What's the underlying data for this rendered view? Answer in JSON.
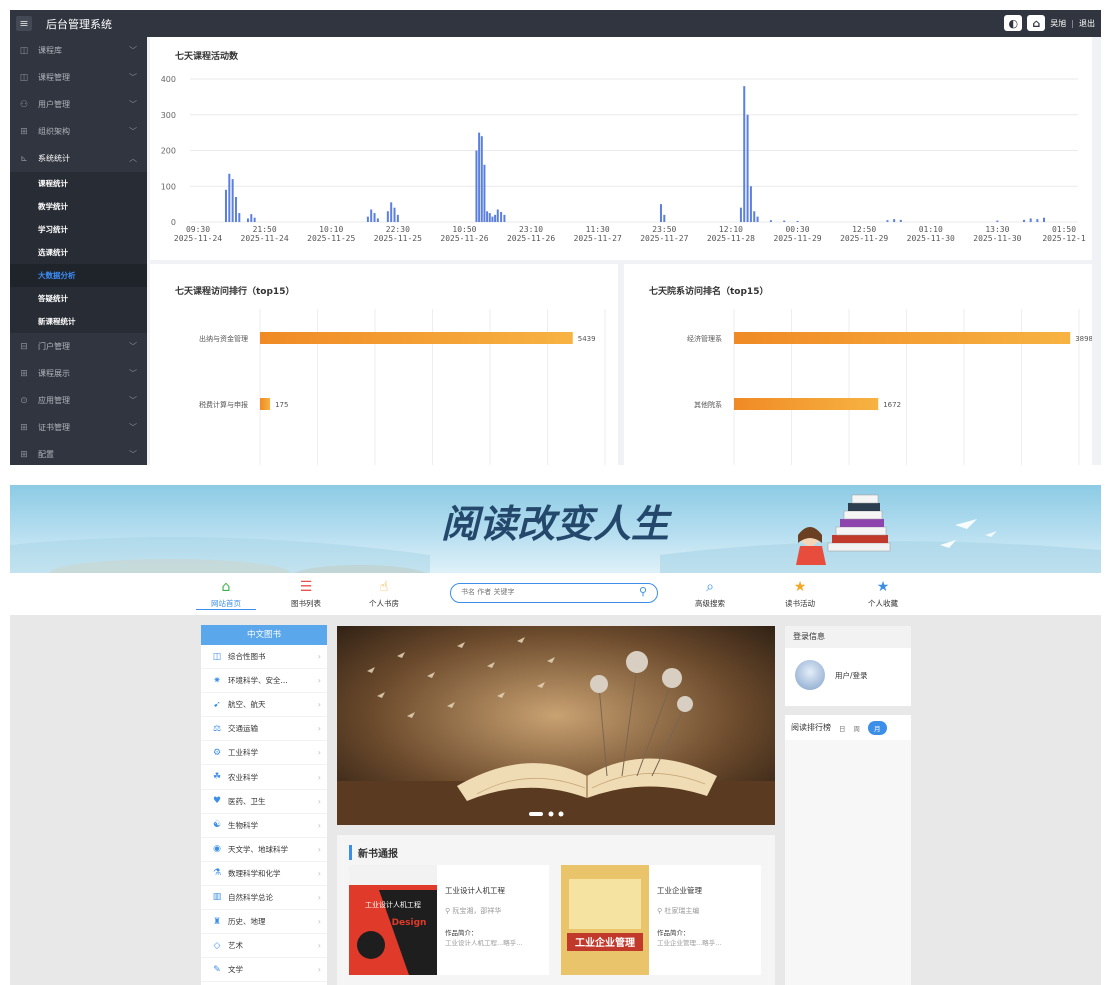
{
  "admin": {
    "app_title": "后台管理系统",
    "user_name": "吴旭",
    "logout": "退出",
    "sidebar": {
      "items_before": [
        {
          "label": "课程库",
          "icon": "book-icon"
        },
        {
          "label": "课程管理",
          "icon": "book-icon"
        },
        {
          "label": "用户管理",
          "icon": "user-icon"
        },
        {
          "label": "组织架构",
          "icon": "grid-icon"
        },
        {
          "label": "系统统计",
          "icon": "chart-icon"
        }
      ],
      "subs": [
        {
          "label": "课程统计"
        },
        {
          "label": "教学统计"
        },
        {
          "label": "学习统计"
        },
        {
          "label": "选课统计"
        },
        {
          "label": "大数据分析"
        },
        {
          "label": "答疑统计"
        },
        {
          "label": "新课程统计"
        }
      ],
      "items_after": [
        {
          "label": "门户管理",
          "icon": "portal-icon"
        },
        {
          "label": "课程展示",
          "icon": "grid-icon"
        },
        {
          "label": "应用管理",
          "icon": "app-icon"
        },
        {
          "label": "证书管理",
          "icon": "grid-icon"
        },
        {
          "label": "配置",
          "icon": "grid-icon"
        }
      ]
    },
    "activity_card": {
      "title": "七天课程活动数"
    },
    "course_card": {
      "title": "七天课程访问排行（top15）"
    },
    "dept_card": {
      "title": "七天院系访问排名（top15）"
    }
  },
  "chart_data": [
    {
      "type": "bar",
      "title": "七天课程活动数",
      "ylim": [
        0,
        400
      ],
      "yticks": [
        0,
        100,
        200,
        300,
        400
      ],
      "xticks": [
        {
          "time": "09:30",
          "date": "2025-11-24"
        },
        {
          "time": "21:50",
          "date": "2025-11-24"
        },
        {
          "time": "10:10",
          "date": "2025-11-25"
        },
        {
          "time": "22:30",
          "date": "2025-11-25"
        },
        {
          "time": "10:50",
          "date": "2025-11-26"
        },
        {
          "time": "23:10",
          "date": "2025-11-26"
        },
        {
          "time": "11:30",
          "date": "2025-11-27"
        },
        {
          "time": "23:50",
          "date": "2025-11-27"
        },
        {
          "time": "12:10",
          "date": "2025-11-28"
        },
        {
          "time": "00:30",
          "date": "2025-11-29"
        },
        {
          "time": "12:50",
          "date": "2025-11-29"
        },
        {
          "time": "01:10",
          "date": "2025-11-30"
        },
        {
          "time": "13:30",
          "date": "2025-11-30"
        },
        {
          "time": "01:50",
          "date": "2025-12-1"
        }
      ],
      "points": [
        {
          "x": 0.42,
          "y": 90
        },
        {
          "x": 0.47,
          "y": 135
        },
        {
          "x": 0.52,
          "y": 120
        },
        {
          "x": 0.57,
          "y": 70
        },
        {
          "x": 0.62,
          "y": 25
        },
        {
          "x": 0.75,
          "y": 10
        },
        {
          "x": 0.8,
          "y": 22
        },
        {
          "x": 0.85,
          "y": 12
        },
        {
          "x": 2.55,
          "y": 15
        },
        {
          "x": 2.6,
          "y": 35
        },
        {
          "x": 2.65,
          "y": 25
        },
        {
          "x": 2.7,
          "y": 10
        },
        {
          "x": 2.85,
          "y": 30
        },
        {
          "x": 2.9,
          "y": 55
        },
        {
          "x": 2.95,
          "y": 40
        },
        {
          "x": 3.0,
          "y": 20
        },
        {
          "x": 4.18,
          "y": 200
        },
        {
          "x": 4.22,
          "y": 250
        },
        {
          "x": 4.26,
          "y": 240
        },
        {
          "x": 4.3,
          "y": 160
        },
        {
          "x": 4.34,
          "y": 30
        },
        {
          "x": 4.38,
          "y": 25
        },
        {
          "x": 4.42,
          "y": 15
        },
        {
          "x": 4.46,
          "y": 20
        },
        {
          "x": 4.5,
          "y": 35
        },
        {
          "x": 4.55,
          "y": 28
        },
        {
          "x": 4.6,
          "y": 20
        },
        {
          "x": 6.95,
          "y": 50
        },
        {
          "x": 7.0,
          "y": 20
        },
        {
          "x": 8.15,
          "y": 40
        },
        {
          "x": 8.2,
          "y": 380
        },
        {
          "x": 8.25,
          "y": 300
        },
        {
          "x": 8.3,
          "y": 100
        },
        {
          "x": 8.35,
          "y": 30
        },
        {
          "x": 8.4,
          "y": 15
        },
        {
          "x": 8.6,
          "y": 5
        },
        {
          "x": 8.8,
          "y": 4
        },
        {
          "x": 9.0,
          "y": 3
        },
        {
          "x": 10.35,
          "y": 5
        },
        {
          "x": 10.45,
          "y": 8
        },
        {
          "x": 10.55,
          "y": 6
        },
        {
          "x": 12.0,
          "y": 4
        },
        {
          "x": 12.4,
          "y": 6
        },
        {
          "x": 12.5,
          "y": 10
        },
        {
          "x": 12.6,
          "y": 8
        },
        {
          "x": 12.7,
          "y": 12
        }
      ]
    },
    {
      "type": "bar",
      "orientation": "horizontal",
      "title": "七天课程访问排行（top15）",
      "categories": [
        "出纳与资金管理",
        "税费计算与申报"
      ],
      "values": [
        5439,
        175
      ],
      "xlim": [
        0,
        6000
      ]
    },
    {
      "type": "bar",
      "orientation": "horizontal",
      "title": "七天院系访问排名（top15）",
      "categories": [
        "经济管理系",
        "其他院系"
      ],
      "values": [
        3898,
        1672
      ],
      "xlim": [
        0,
        4000
      ]
    }
  ],
  "library": {
    "banner_slogan": "阅读改变人生",
    "nav": [
      {
        "label": "网站首页",
        "icon": "home-icon",
        "color": "#3bb24a"
      },
      {
        "label": "图书列表",
        "icon": "list-icon",
        "color": "#e8524a"
      },
      {
        "label": "个人书房",
        "icon": "thumbs-up-icon",
        "color": "#f5a623"
      },
      {
        "label": "高级搜索",
        "icon": "advanced-search-icon",
        "color": "#3b8fe8"
      },
      {
        "label": "读书活动",
        "icon": "star-icon",
        "color": "#f5a623"
      },
      {
        "label": "个人收藏",
        "icon": "star-icon",
        "color": "#3b8fe8"
      }
    ],
    "search_placeholder": "书名 作者 关键字",
    "category_header": "中文图书",
    "categories": [
      {
        "label": "综合性图书",
        "icon": "book-icon"
      },
      {
        "label": "环境科学、安全...",
        "icon": "sun-icon"
      },
      {
        "label": "航空、航天",
        "icon": "rocket-icon"
      },
      {
        "label": "交通运输",
        "icon": "scale-icon"
      },
      {
        "label": "工业科学",
        "icon": "gear-icon"
      },
      {
        "label": "农业科学",
        "icon": "plant-icon"
      },
      {
        "label": "医药、卫生",
        "icon": "heart-icon"
      },
      {
        "label": "生物科学",
        "icon": "bio-icon"
      },
      {
        "label": "天文学、地球科学",
        "icon": "globe-icon"
      },
      {
        "label": "数理科学和化学",
        "icon": "flask-icon"
      },
      {
        "label": "自然科学总论",
        "icon": "bars-icon"
      },
      {
        "label": "历史、地理",
        "icon": "history-icon"
      },
      {
        "label": "艺术",
        "icon": "code-icon"
      },
      {
        "label": "文学",
        "icon": "lit-icon"
      }
    ],
    "new_books": {
      "title": "新书通报",
      "books": [
        {
          "title": "工业设计人机工程",
          "author": "阮宝湘，邵祥华",
          "intro_label": "作品简介：",
          "intro": "工业设计人机工程...略乎...",
          "cover_text": "工业设计人机工程"
        },
        {
          "title": "工业企业管理",
          "author": "杜家瑞主编",
          "intro_label": "作品简介：",
          "intro": "工业企业管理...略乎...",
          "cover_text": "工业企业管理"
        }
      ]
    },
    "login": {
      "title": "登录信息",
      "user_text": "用户/登录"
    },
    "ranking": {
      "title": "阅读排行榜",
      "tabs": [
        "日",
        "周",
        "月"
      ],
      "active_tab": "月"
    }
  }
}
